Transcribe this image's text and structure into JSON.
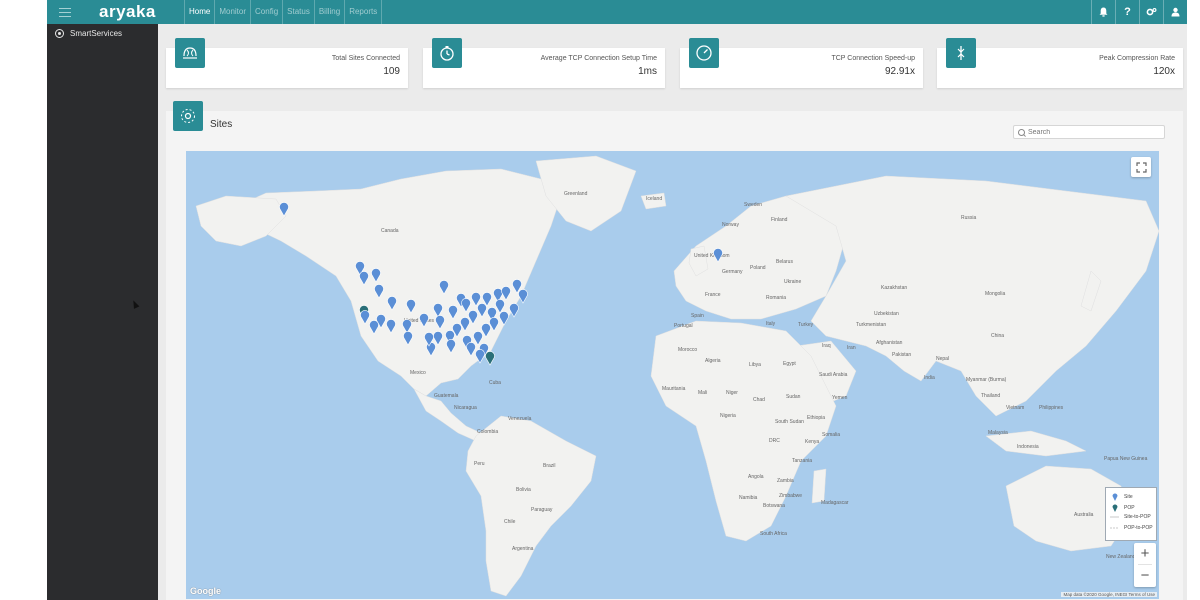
{
  "app": {
    "brand": "aryaka",
    "nav_tabs": [
      "Home",
      "Monitor",
      "Config",
      "Status",
      "Billing",
      "Reports"
    ],
    "active_tab": "Home",
    "top_icons": [
      "bell-icon",
      "help-icon",
      "settings-icon",
      "user-icon"
    ]
  },
  "sidebar": {
    "items": [
      {
        "label": "SmartServices",
        "icon": "smart-services-icon"
      }
    ]
  },
  "stats": [
    {
      "label": "Total Sites Connected",
      "value": "109",
      "icon": "sites-icon"
    },
    {
      "label": "Average TCP Connection Setup Time",
      "value": "1ms",
      "icon": "timer-icon"
    },
    {
      "label": "TCP Connection Speed-up",
      "value": "92.91x",
      "icon": "speedometer-icon"
    },
    {
      "label": "Peak Compression Rate",
      "value": "120x",
      "icon": "compression-icon"
    }
  ],
  "sites_panel": {
    "title": "Sites",
    "search_placeholder": "Search"
  },
  "map": {
    "country_labels": [
      "Greenland",
      "Iceland",
      "Sweden",
      "Finland",
      "Norway",
      "Russia",
      "United Kingdom",
      "Germany",
      "Poland",
      "Belarus",
      "Ukraine",
      "France",
      "Romania",
      "Kazakhstan",
      "Mongolia",
      "Spain",
      "Portugal",
      "Italy",
      "Turkey",
      "Uzbekistan",
      "Turkmenistan",
      "China",
      "Afghanistan",
      "Iraq",
      "Iran",
      "Pakistan",
      "Nepal",
      "India",
      "Morocco",
      "Algeria",
      "Libya",
      "Egypt",
      "Saudi Arabia",
      "Myanmar (Burma)",
      "Thailand",
      "Mauritania",
      "Mali",
      "Niger",
      "Chad",
      "Sudan",
      "Yemen",
      "Vietnam",
      "Philippines",
      "Nigeria",
      "Ethiopia",
      "South Sudan",
      "Somalia",
      "Kenya",
      "Malaysia",
      "DRC",
      "Tanzania",
      "Indonesia",
      "Papua New Guinea",
      "Angola",
      "Zambia",
      "Namibia",
      "Zimbabwe",
      "Botswana",
      "Madagascar",
      "South Africa",
      "Australia",
      "New Zealand",
      "Canada",
      "United States",
      "Mexico",
      "Cuba",
      "Guatemala",
      "Nicaragua",
      "Venezuela",
      "Colombia",
      "Peru",
      "Brazil",
      "Bolivia",
      "Paraguay",
      "Chile",
      "Argentina"
    ],
    "legend": [
      {
        "label": "Site",
        "color": "#5b8fd6"
      },
      {
        "label": "POP",
        "color": "#2a6f78"
      },
      {
        "label": "Site-to-POP",
        "color": "#c8c8c8"
      },
      {
        "label": "POP-to-POP",
        "color": "#c8c8c8"
      }
    ],
    "zoom_in": "+",
    "zoom_out": "−",
    "google_logo": "Google",
    "attribution": "Map data ©2020 Google, INEGI   Terms of Use",
    "fullscreen_icon": "fullscreen-icon"
  }
}
